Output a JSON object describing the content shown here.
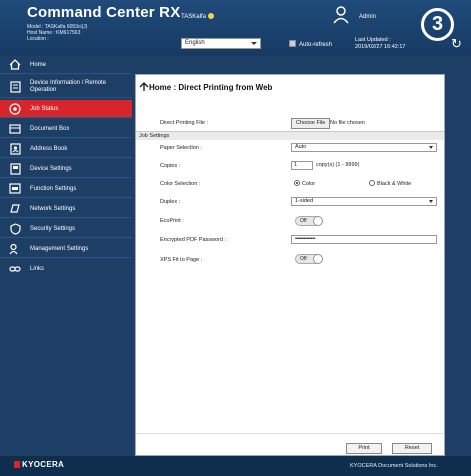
{
  "header": {
    "app_title": "Command Center RX",
    "model_line": "Model : TASKalfa 6053ci(J)",
    "host_line": "Host Name : KM617563",
    "location_line": "Location :",
    "device_name": "TASKalfa",
    "admin_label": "Admin",
    "step_number": "3",
    "language": "English",
    "auto_refresh_label": "Auto-refresh",
    "last_updated_label": "Last Updated :",
    "last_updated_value": "2019/02/27 16:42:17"
  },
  "sidebar": {
    "items": [
      {
        "label": "Home",
        "icon": "home-icon"
      },
      {
        "label": "Device Information / Remote Operation",
        "icon": "device-info-icon"
      },
      {
        "label": "Job Status",
        "icon": "job-status-icon",
        "active": true
      },
      {
        "label": "Document Box",
        "icon": "document-box-icon"
      },
      {
        "label": "Address Book",
        "icon": "address-book-icon"
      },
      {
        "label": "Device Settings",
        "icon": "device-settings-icon"
      },
      {
        "label": "Function Settings",
        "icon": "function-settings-icon"
      },
      {
        "label": "Network Settings",
        "icon": "network-settings-icon"
      },
      {
        "label": "Security Settings",
        "icon": "security-settings-icon"
      },
      {
        "label": "Management Settings",
        "icon": "management-settings-icon"
      },
      {
        "label": "Links",
        "icon": "links-icon"
      }
    ]
  },
  "main": {
    "breadcrumb_title": "Home : Direct Printing from Web",
    "direct_printing_file_label": "Direct Printing File :",
    "choose_file_label": "Choose File",
    "no_file_label": "No file chosen",
    "job_settings_label": "Job Settings",
    "paper_selection_label": "Paper Selection :",
    "paper_selection_value": "Auto",
    "copies_label": "Copies :",
    "copies_value": "1",
    "copies_hint": "copy(s) (1 - 9999)",
    "color_selection_label": "Color Selection :",
    "color_option": "Color",
    "bw_option": "Black & White",
    "duplex_label": "Duplex :",
    "duplex_value": "1-sided",
    "ecoprint_label": "EcoPrint :",
    "ecoprint_value": "Off",
    "encrypted_pdf_label": "Encrypted PDF Password :",
    "encrypted_pdf_value": "••••••••••••••",
    "xps_fit_label": "XPS Fit to Page :",
    "xps_fit_value": "Off",
    "print_button": "Print",
    "reset_button": "Reset"
  },
  "footer": {
    "logo_text": "KYOCERA",
    "copyright": "KYOCERA Document Solutions Inc."
  },
  "colors": {
    "header_bg": "#1f4a7a",
    "sidebar_bg": "#1d3f66",
    "active_item": "#d6252b"
  }
}
